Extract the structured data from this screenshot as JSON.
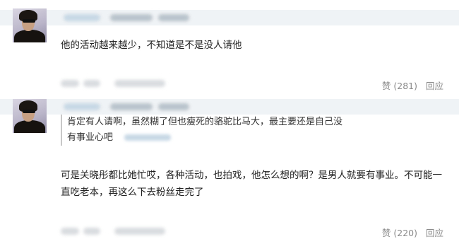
{
  "comments": [
    {
      "text": "他的活动越来越少，不知道是不是没人请他",
      "like_label": "赞 (281)",
      "reply_label": "回应"
    },
    {
      "quote": {
        "line1": "肯定有人请啊，虽然糊了但也瘦死的骆驼比马大，最主要还是自己没",
        "line2": "有事业心吧"
      },
      "text_line1": "可是关晓彤都比她忙哎，各种活动，也拍戏，他怎么想的啊？是男人就要有事业。不可能一",
      "text_line2": "直吃老本，再这么下去粉丝走完了",
      "like_label": "赞 (220)",
      "reply_label": "回应"
    }
  ]
}
